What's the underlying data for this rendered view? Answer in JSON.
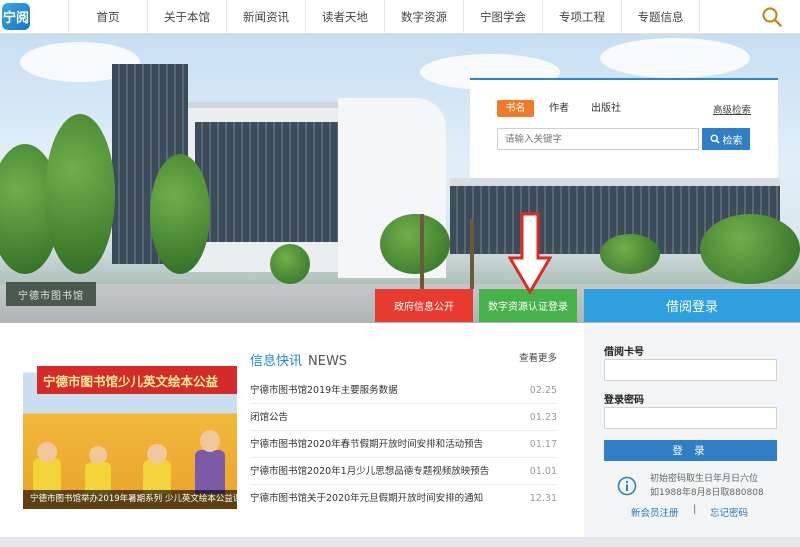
{
  "logo": {
    "text": "宁阅"
  },
  "nav": {
    "items": [
      "首页",
      "关于本馆",
      "新闻资讯",
      "读者天地",
      "数字资源",
      "宁图学会",
      "专项工程",
      "专题信息"
    ]
  },
  "hero": {
    "stone_text": "宁德市图书馆"
  },
  "search": {
    "tabs": [
      "书名",
      "作者",
      "出版社"
    ],
    "active_tab": "书名",
    "advanced": "高级检索",
    "placeholder": "请输入关键字",
    "button": "检索"
  },
  "quick": {
    "gov": "政府信息公开",
    "digital": "数字资源认证登录",
    "login": "借阅登录"
  },
  "news": {
    "title_cn": "信息快讯",
    "title_en": "NEWS",
    "more": "查看更多",
    "photo_banner": "宁德市图书馆少儿英文绘本公益",
    "photo_caption": "宁德市图书馆举办2019年暑期系列 少儿英文绘本公益课",
    "items": [
      {
        "title": "宁德市图书馆2019年主要服务数据",
        "date": "02.25"
      },
      {
        "title": "闭馆公告",
        "date": "01.23"
      },
      {
        "title": "宁德市图书馆2020年春节假期开放时间安排和活动预告",
        "date": "01.17"
      },
      {
        "title": "宁德市图书馆2020年1月少儿思想品德专题视频放映预告",
        "date": "01.01"
      },
      {
        "title": "宁德市图书馆关于2020年元旦假期开放时间安排的通知",
        "date": "12.31"
      }
    ]
  },
  "login": {
    "card_label": "借阅卡号",
    "pwd_label": "登录密码",
    "button": "登 录",
    "hint_line1": "初始密码取生日年月日六位",
    "hint_line2": "如1988年8月8日取880808",
    "register": "新会员注册",
    "separator": "|",
    "forgot": "忘记密码"
  },
  "colors": {
    "accent": "#2e7fc5",
    "gov": "#e83b30",
    "digital": "#45b24a",
    "login_tab": "#2ea0df",
    "orange": "#f07a2a"
  }
}
